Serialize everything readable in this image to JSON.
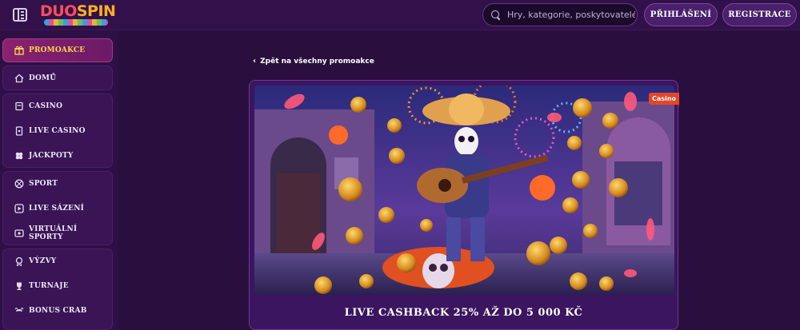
{
  "brand": {
    "logo_part1": "DUO",
    "logo_part2": "SPIN"
  },
  "header": {
    "search_placeholder": "Hry, kategorie, poskytovatelé",
    "login_label": "PŘIHLÁŠENÍ",
    "register_label": "REGISTRACE"
  },
  "sidebar": {
    "promo": {
      "label": "PROMOAKCE",
      "icon": "gift-icon"
    },
    "home": {
      "label": "DOMŮ",
      "icon": "house-icon"
    },
    "casino_group": [
      {
        "label": "CASINO",
        "icon": "slot-machine-icon"
      },
      {
        "label": "LIVE CASINO",
        "icon": "card-icon"
      },
      {
        "label": "JACKPOTY",
        "icon": "clover-icon"
      }
    ],
    "sport_group": [
      {
        "label": "SPORT",
        "icon": "ball-icon"
      },
      {
        "label": "LIVE SÁZENÍ",
        "icon": "play-icon"
      },
      {
        "label": "VIRTUÁLNÍ SPORTY",
        "icon": "virtual-icon"
      }
    ],
    "extras_group": [
      {
        "label": "VÝZVY",
        "icon": "medal-icon"
      },
      {
        "label": "TURNAJE",
        "icon": "trophy-icon"
      },
      {
        "label": "BONUS CRAB",
        "icon": "crab-icon"
      }
    ]
  },
  "main": {
    "back_label": "Zpět na všechny promoakce",
    "promo": {
      "tag": "Casino",
      "title": "LIVE CASHBACK 25% AŽ DO 5 000 KČ"
    }
  },
  "colors": {
    "background": "#2a0f3e",
    "accent_gold": "#ffd54a",
    "tag_red": "#e3472a",
    "promo_active": "#8a2270"
  }
}
